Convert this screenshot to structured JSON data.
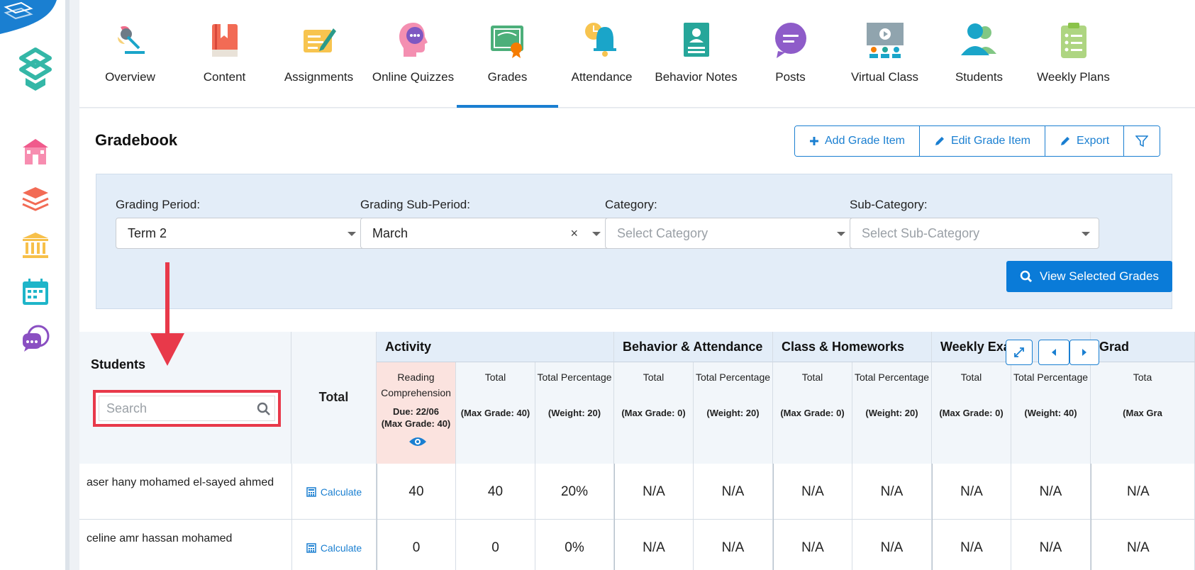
{
  "nav": {
    "tabs": [
      {
        "label": "Overview"
      },
      {
        "label": "Content"
      },
      {
        "label": "Assignments"
      },
      {
        "label": "Online Quizzes"
      },
      {
        "label": "Grades"
      },
      {
        "label": "Attendance"
      },
      {
        "label": "Behavior Notes"
      },
      {
        "label": "Posts"
      },
      {
        "label": "Virtual Class"
      },
      {
        "label": "Students"
      },
      {
        "label": "Weekly Plans"
      }
    ],
    "active": "Grades"
  },
  "sidebar": {
    "icons": [
      "school-icon",
      "layers-icon",
      "institution-icon",
      "calendar-icon",
      "chat-icon"
    ]
  },
  "gradebook": {
    "title": "Gradebook",
    "actions": {
      "add": "Add Grade Item",
      "edit": "Edit Grade Item",
      "export": "Export"
    }
  },
  "filters": {
    "grading_period": {
      "label": "Grading Period:",
      "value": "Term 2"
    },
    "sub_period": {
      "label": "Grading Sub-Period:",
      "value": "March"
    },
    "category": {
      "label": "Category:",
      "placeholder": "Select Category"
    },
    "sub_category": {
      "label": "Sub-Category:",
      "placeholder": "Select Sub-Category"
    },
    "view_button": "View Selected Grades"
  },
  "table": {
    "students_header": "Students",
    "search_placeholder": "Search",
    "total_header": "Total",
    "categories": [
      {
        "name": "Activity"
      },
      {
        "name": "Behavior & Attendance"
      },
      {
        "name": "Class & Homeworks"
      },
      {
        "name": "Weekly Exam"
      },
      {
        "name": "Grad"
      }
    ],
    "reading": {
      "title": "Reading Comprehension",
      "due": "Due: 22/06",
      "max": "(Max Grade: 40)"
    },
    "subcols": [
      {
        "title": "Total",
        "meta": "(Max Grade: 40)"
      },
      {
        "title": "Total Percentage",
        "meta": "(Weight: 20)"
      },
      {
        "title": "Total",
        "meta": "(Max Grade: 0)"
      },
      {
        "title": "Total Percentage",
        "meta": "(Weight: 20)"
      },
      {
        "title": "Total",
        "meta": "(Max Grade: 0)"
      },
      {
        "title": "Total Percentage",
        "meta": "(Weight: 20)"
      },
      {
        "title": "Total",
        "meta": "(Max Grade: 0)"
      },
      {
        "title": "Total Percentage",
        "meta": "(Weight: 40)"
      },
      {
        "title": "Tota",
        "meta": "(Max Gra"
      }
    ],
    "calculate_label": "Calculate",
    "rows": [
      {
        "name": "aser hany mohamed el-sayed ahmed",
        "cells": [
          "40",
          "40",
          "20%",
          "N/A",
          "N/A",
          "N/A",
          "N/A",
          "N/A",
          "N/A",
          "N/A"
        ]
      },
      {
        "name": "celine amr hassan mohamed",
        "cells": [
          "0",
          "0",
          "0%",
          "N/A",
          "N/A",
          "N/A",
          "N/A",
          "N/A",
          "N/A",
          "N/A"
        ]
      }
    ]
  },
  "colors": {
    "accent": "#1a7fd1",
    "primary_button": "#0a7bd8",
    "highlight": "#e8394a",
    "reading_bg": "#fbe3df"
  }
}
